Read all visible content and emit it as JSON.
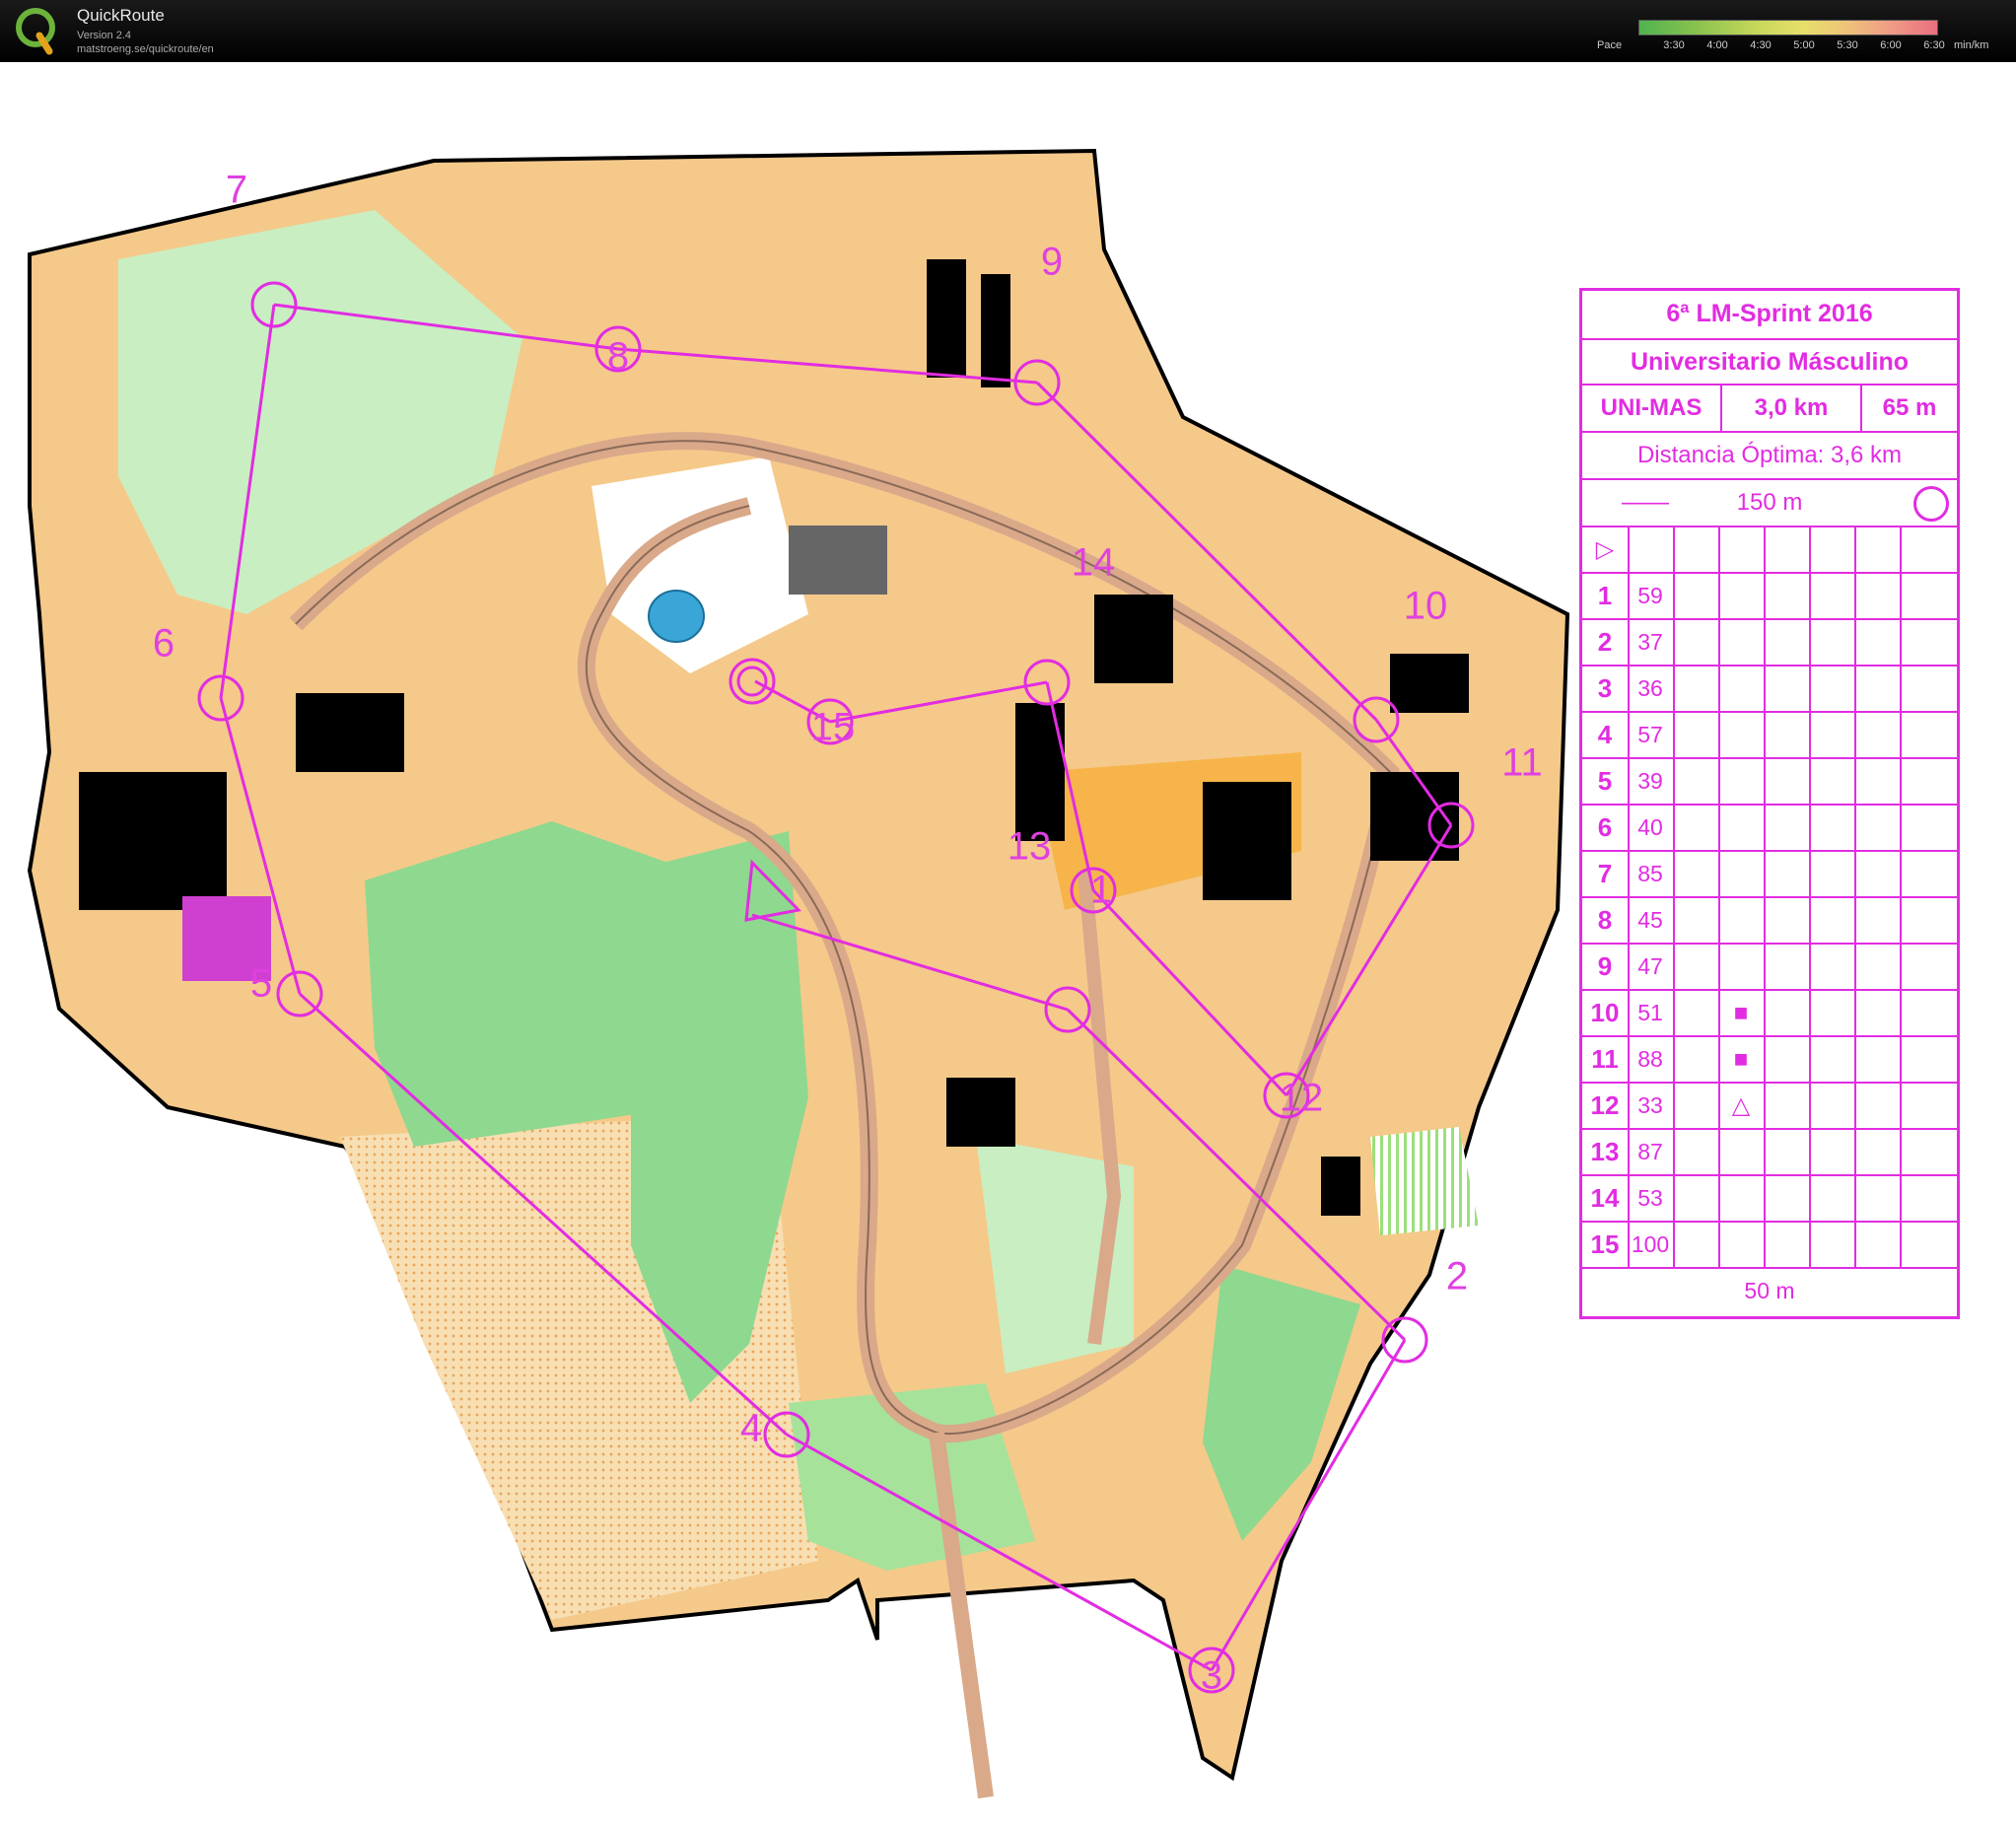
{
  "app": {
    "name": "QuickRoute",
    "version": "Version 2.4",
    "url": "matstroeng.se/quickroute/en"
  },
  "pace": {
    "label": "Pace",
    "ticks": [
      "3:30",
      "4:00",
      "4:30",
      "5:00",
      "5:30",
      "6:00",
      "6:30"
    ],
    "unit": "min/km"
  },
  "course": {
    "title": "6ª LM-Sprint 2016",
    "class": "Universitario Másculino",
    "code": "UNI-MAS",
    "length": "3,0 km",
    "climb": "65 m",
    "optimal": "Distancia Óptima: 3,6 km",
    "start_marker": "150 m",
    "finish_marker": "50 m",
    "controls": [
      {
        "n": "1",
        "code": "59"
      },
      {
        "n": "2",
        "code": "37"
      },
      {
        "n": "3",
        "code": "36"
      },
      {
        "n": "4",
        "code": "57"
      },
      {
        "n": "5",
        "code": "39"
      },
      {
        "n": "6",
        "code": "40"
      },
      {
        "n": "7",
        "code": "85"
      },
      {
        "n": "8",
        "code": "45"
      },
      {
        "n": "9",
        "code": "47"
      },
      {
        "n": "10",
        "code": "51"
      },
      {
        "n": "11",
        "code": "88"
      },
      {
        "n": "12",
        "code": "33"
      },
      {
        "n": "13",
        "code": "87"
      },
      {
        "n": "14",
        "code": "53"
      },
      {
        "n": "15",
        "code": "100"
      }
    ]
  },
  "map_labels": [
    "1",
    "2",
    "3",
    "4",
    "5",
    "6",
    "7",
    "8",
    "9",
    "10",
    "11",
    "12",
    "13",
    "14",
    "15"
  ],
  "colors": {
    "course": "#e22ce2",
    "open": "#f5c98a",
    "rough_open": "#f7b44a",
    "forest_green": "#8fd88f",
    "light_green": "#c9eec2",
    "building": "#000000",
    "paved": "#d9a98a",
    "water": "#3aa6d8"
  }
}
